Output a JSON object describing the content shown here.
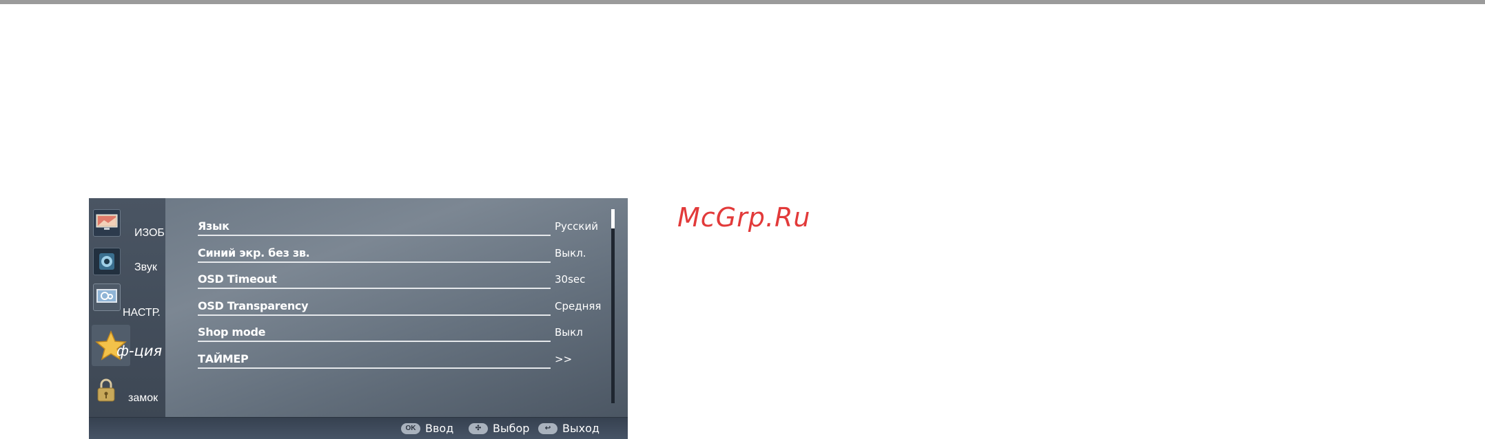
{
  "watermark": "McGrp.Ru",
  "sidebar": {
    "items": [
      {
        "label": "ИЗОБ.",
        "icon": "picture-icon"
      },
      {
        "label": "Звук",
        "icon": "speaker-icon"
      },
      {
        "label": "НАСТР.",
        "icon": "settings-icon"
      },
      {
        "label": "ф-ция",
        "icon": "star-icon"
      },
      {
        "label": "замок",
        "icon": "lock-icon"
      }
    ],
    "active": "ф-ция"
  },
  "menu": {
    "rows": [
      {
        "label": "Язык",
        "value": "Русский"
      },
      {
        "label": "Синий экр. без зв.",
        "value": "Выкл."
      },
      {
        "label": "OSD Timeout",
        "value": "30sec"
      },
      {
        "label": "OSD Transparency",
        "value": "Средняя"
      },
      {
        "label": "Shop mode",
        "value": "Выкл"
      },
      {
        "label": "ТАЙМЕР",
        "value": ">>"
      }
    ]
  },
  "footer": {
    "hints": [
      {
        "key": "OK",
        "label": "Ввод",
        "icon": "ok-button-icon"
      },
      {
        "key": "✣",
        "label": "Выбор",
        "icon": "dpad-icon"
      },
      {
        "key": "↩",
        "label": "Выход",
        "icon": "return-icon"
      }
    ]
  }
}
